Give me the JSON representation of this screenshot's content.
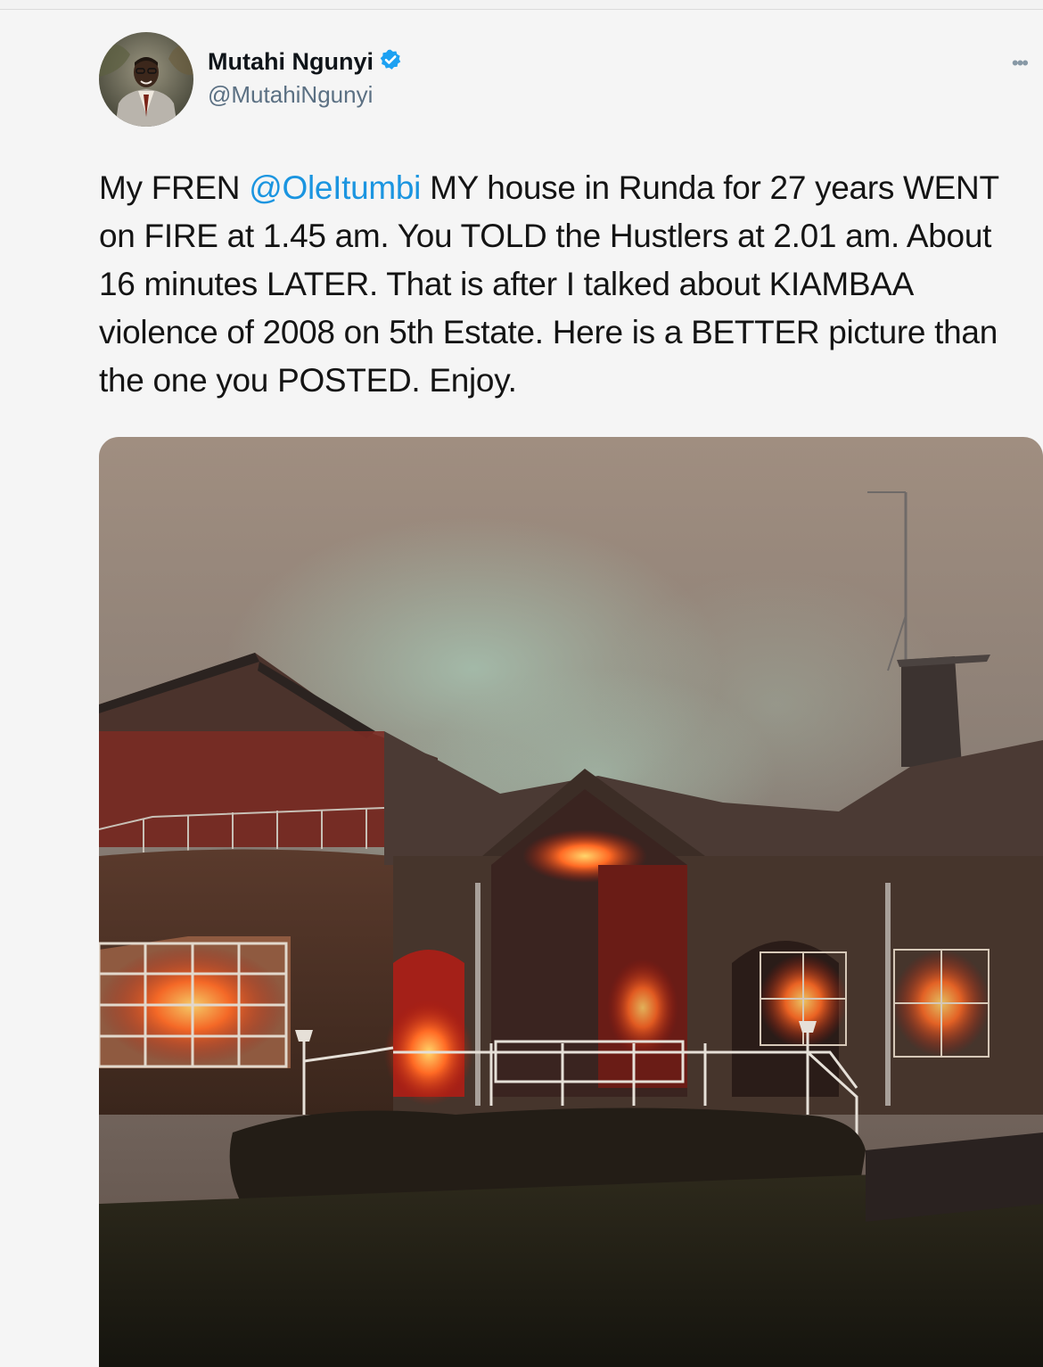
{
  "tweet": {
    "author": {
      "display_name": "Mutahi Ngunyi",
      "handle": "@MutahiNgunyi",
      "verified": true
    },
    "more_icon": "more-dots-icon",
    "text": {
      "part1": "My FREN ",
      "mention": "@OleItumbi",
      "part2": " MY house in Runda for 27 years WENT on FIRE at 1.45 am. You TOLD the Hustlers at 2.01 am. About 16 minutes LATER. That is after I talked about KIAMBAA violence of 2008 on 5th Estate. Here is a BETTER picture than the one you POSTED. Enjoy."
    },
    "media": {
      "type": "photo"
    }
  },
  "colors": {
    "link": "#1b95e0",
    "verified_badge": "#1da1f2",
    "text": "#141414",
    "secondary": "#5b7083",
    "background": "#f5f5f5"
  }
}
